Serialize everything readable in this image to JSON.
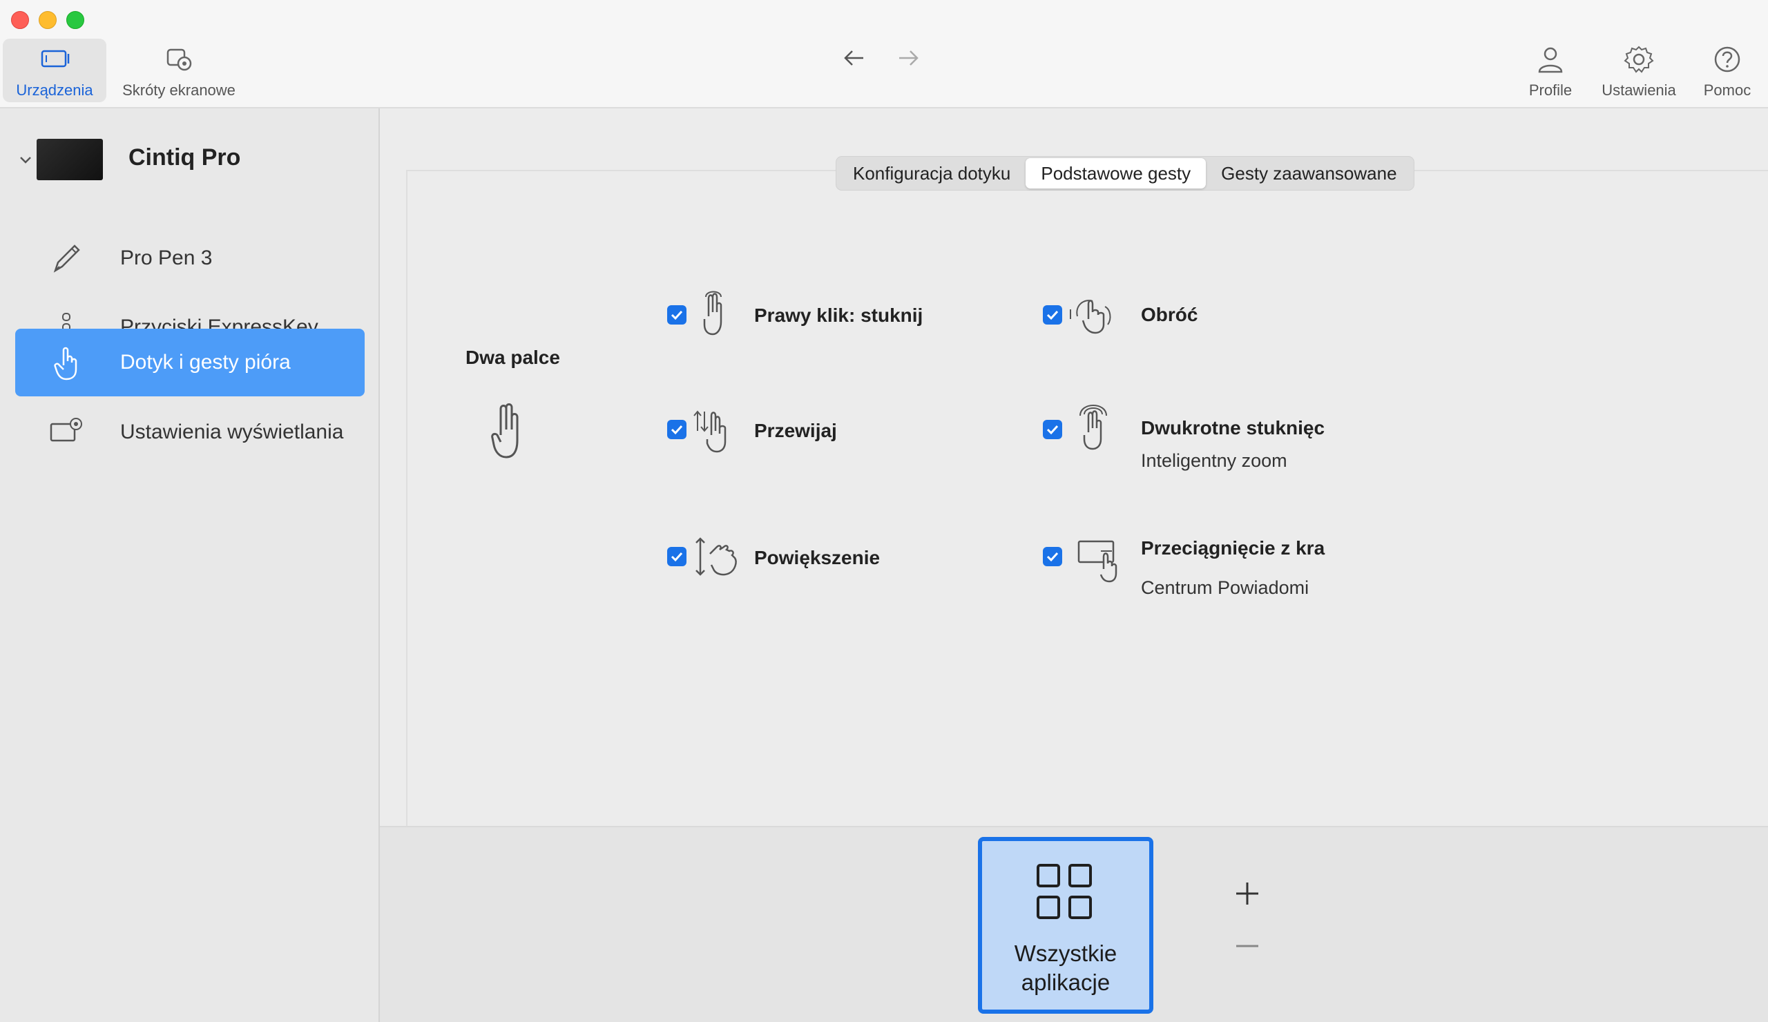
{
  "toolbar": {
    "devices_label": "Urządzenia",
    "shortcuts_label": "Skróty ekranowe",
    "profile_label": "Profile",
    "settings_label": "Ustawienia",
    "help_label": "Pomoc",
    "accent_color": "#1a63d8"
  },
  "sidebar": {
    "device_name": "Cintiq Pro",
    "items": [
      {
        "label": "Pro Pen 3",
        "icon": "pen-icon"
      },
      {
        "label": "Przyciski ExpressKey",
        "icon": "expresskey-icon"
      },
      {
        "label": "Dotyk i gesty pióra",
        "icon": "hand-touch-icon",
        "active": true
      },
      {
        "label": "Ustawienia wyświetlania",
        "icon": "display-settings-icon"
      }
    ],
    "active_color": "#4d9cf8"
  },
  "tabs": [
    {
      "label": "Konfiguracja dotyku"
    },
    {
      "label": "Podstawowe gesty",
      "active": true
    },
    {
      "label": "Gesty zaawansowane"
    }
  ],
  "gesture_group": {
    "label": "Dwa palce",
    "gestures": [
      {
        "title": "Prawy klik: stuknij",
        "checked": true,
        "icon": "two-finger-tap-icon"
      },
      {
        "title": "Obróć",
        "checked": true,
        "icon": "rotate-gesture-icon"
      },
      {
        "title": "Przewijaj",
        "checked": true,
        "icon": "scroll-gesture-icon"
      },
      {
        "title": "Dwukrotne stuknięc",
        "subtitle": "Inteligentny zoom",
        "checked": true,
        "icon": "double-tap-icon"
      },
      {
        "title": "Powiększenie",
        "checked": true,
        "icon": "pinch-zoom-icon"
      },
      {
        "title": "Przeciągnięcie z kra",
        "subtitle": "Centrum Powiadomi",
        "checked": true,
        "icon": "edge-swipe-icon"
      }
    ]
  },
  "apps": {
    "tile_line1": "Wszystkie",
    "tile_line2": "aplikacje",
    "add_symbol": "+",
    "remove_symbol": "—"
  }
}
